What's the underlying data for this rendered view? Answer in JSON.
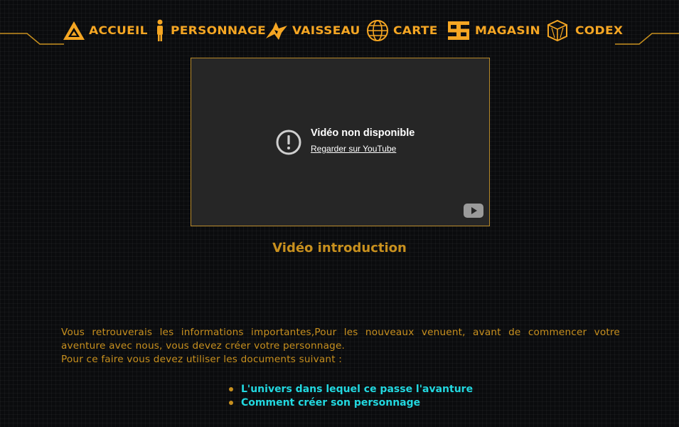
{
  "nav": {
    "items": [
      {
        "label": "ACCUEIL",
        "icon": "home-chevron-icon"
      },
      {
        "label": "PERSONNAGE",
        "icon": "person-icon"
      },
      {
        "label": "VAISSEAU",
        "icon": "spaceship-icon"
      },
      {
        "label": "CARTE",
        "icon": "globe-icon"
      },
      {
        "label": "MAGASIN",
        "icon": "shop-credits-icon"
      },
      {
        "label": "CODEX",
        "icon": "cube-icon"
      }
    ],
    "accent_color": "#f5a623"
  },
  "video": {
    "error_title": "Vidéo non disponible",
    "watch_link": "Regarder sur YouTube"
  },
  "caption": "Vidéo introduction",
  "intro": {
    "paragraph": "Vous retrouverais les informations importantes,Pour les nouveaux venuent, avant de commencer votre aventure avec nous, vous devez créer votre personnage.",
    "line2": "Pour ce faire vous devez utiliser les documents suivant :"
  },
  "documents": [
    {
      "label": "L'univers dans lequel ce passe l'avanture"
    },
    {
      "label": "Comment créer son personnage"
    }
  ],
  "colors": {
    "text_gold": "#c8901e",
    "link_cyan": "#22d8e0",
    "background": "#0a0b0d"
  }
}
